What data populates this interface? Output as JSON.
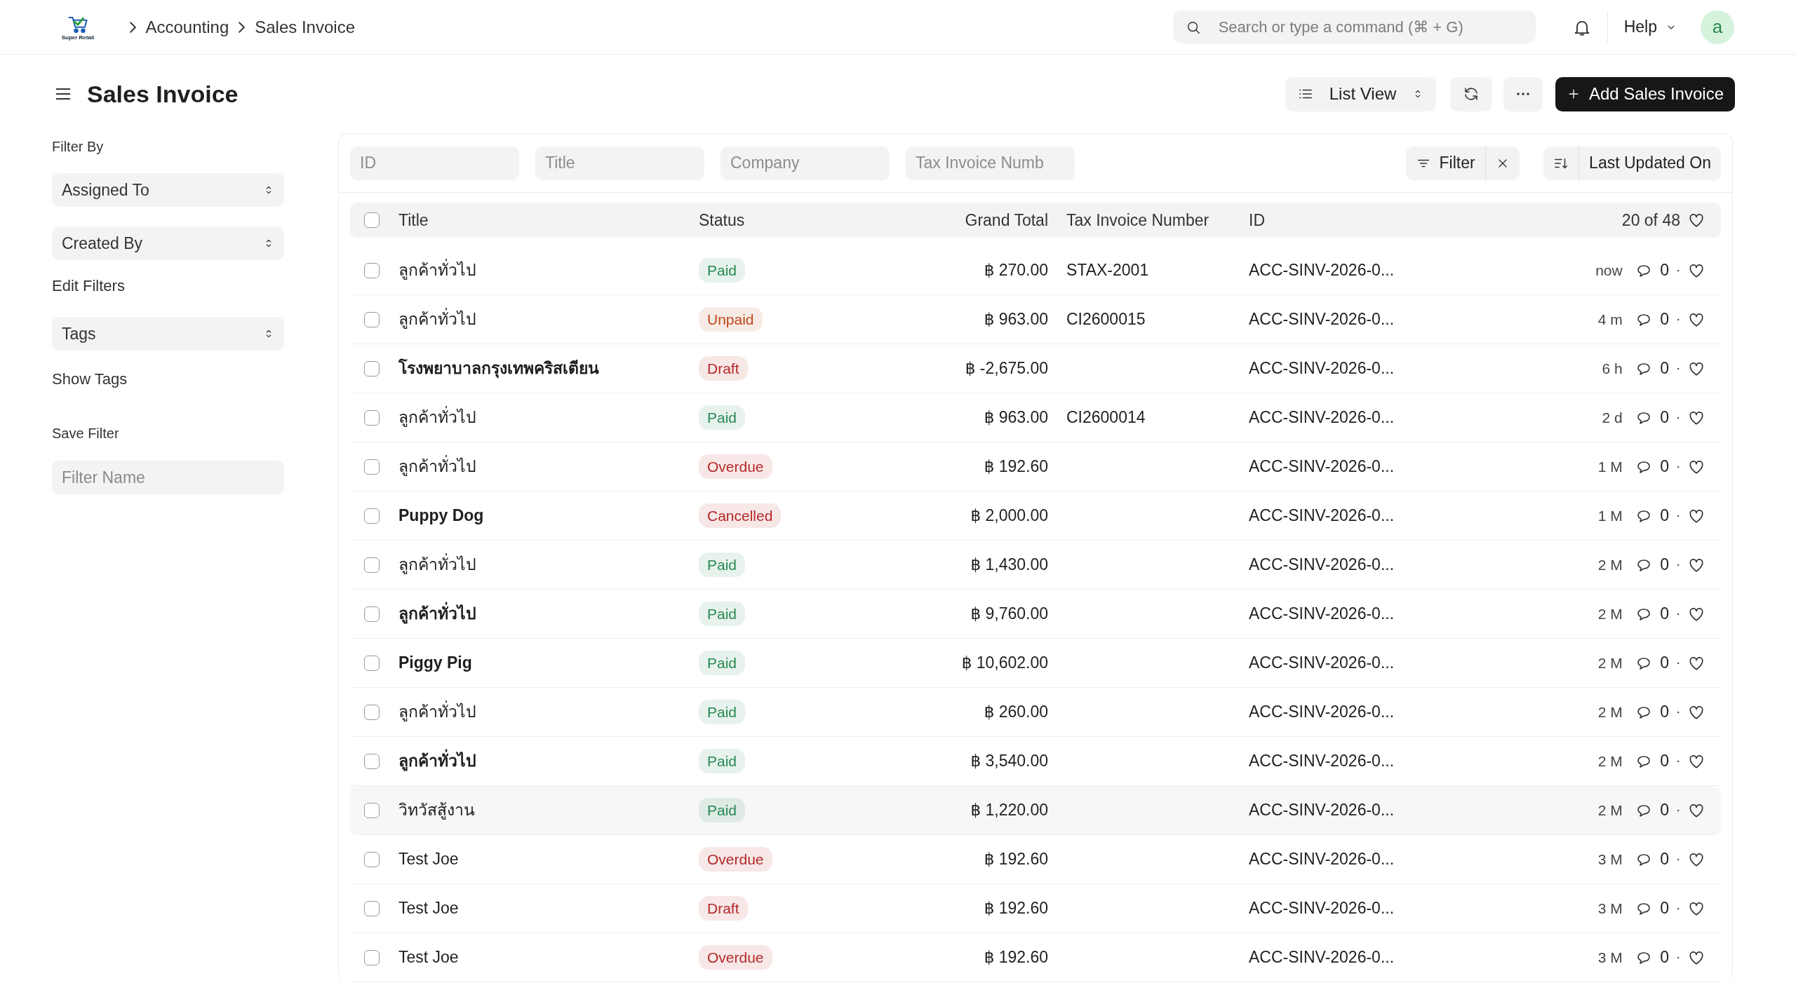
{
  "topbar": {
    "logo_text": "Super Retail",
    "breadcrumbs": [
      "Accounting",
      "Sales Invoice"
    ],
    "search": {
      "placeholder": "Search or type a command (⌘ + G)"
    },
    "help": "Help",
    "avatar": "a"
  },
  "page": {
    "title": "Sales Invoice",
    "view_switcher": "List View",
    "primary_action": "Add Sales Invoice"
  },
  "sidebar": {
    "filter_by": "Filter By",
    "filters": [
      {
        "label": "Assigned To"
      },
      {
        "label": "Created By"
      }
    ],
    "edit_filters": "Edit Filters",
    "tags": "Tags",
    "show_tags": "Show Tags",
    "save_filter": "Save Filter",
    "filter_name": {
      "placeholder": "Filter Name"
    }
  },
  "filter_bar": {
    "fields": [
      {
        "placeholder": "ID"
      },
      {
        "placeholder": "Title"
      },
      {
        "placeholder": "Company"
      },
      {
        "placeholder": "Tax Invoice Numb"
      }
    ],
    "filter_button": "Filter",
    "sort_label": "Last Updated On"
  },
  "table": {
    "header_checked": false,
    "columns": [
      "Title",
      "Status",
      "Grand Total",
      "Tax Invoice Number",
      "ID"
    ],
    "count": "20 of 48",
    "rows": [
      {
        "checked": false,
        "hovered": false,
        "unread": false,
        "title": "ลูกค้าทั่วไป",
        "status": "Paid",
        "color": "#278a53",
        "grand_total": "฿ 270.00",
        "tax_invoice_number": "STAX-2001",
        "id": "ACC-SINV-2026-0...",
        "modified": "now",
        "comments": "0"
      },
      {
        "checked": false,
        "hovered": false,
        "unread": false,
        "title": "ลูกค้าทั่วไป",
        "status": "Unpaid",
        "color": "#c0461b",
        "grand_total": "฿ 963.00",
        "tax_invoice_number": "CI2600015",
        "id": "ACC-SINV-2026-0...",
        "modified": "4 m",
        "comments": "0"
      },
      {
        "checked": false,
        "hovered": false,
        "unread": true,
        "title": "โรงพยาบาลกรุงเทพคริสเตียน",
        "status": "Draft",
        "color": "#b42828",
        "grand_total": "฿ -2,675.00",
        "id": "ACC-SINV-2026-0...",
        "modified": "6 h",
        "comments": "0"
      },
      {
        "checked": false,
        "hovered": false,
        "unread": false,
        "title": "ลูกค้าทั่วไป",
        "status": "Paid",
        "color": "#278a53",
        "grand_total": "฿ 963.00",
        "tax_invoice_number": "CI2600014",
        "id": "ACC-SINV-2026-0...",
        "modified": "2 d",
        "comments": "0"
      },
      {
        "checked": false,
        "hovered": false,
        "unread": false,
        "title": "ลูกค้าทั่วไป",
        "status": "Overdue",
        "color": "#b42828",
        "grand_total": "฿ 192.60",
        "id": "ACC-SINV-2026-0...",
        "modified": "1 M",
        "comments": "0"
      },
      {
        "checked": false,
        "hovered": false,
        "unread": true,
        "title": "Puppy Dog",
        "status": "Cancelled",
        "color": "#b42828",
        "grand_total": "฿ 2,000.00",
        "id": "ACC-SINV-2026-0...",
        "modified": "1 M",
        "comments": "0"
      },
      {
        "checked": false,
        "hovered": false,
        "unread": false,
        "title": "ลูกค้าทั่วไป",
        "status": "Paid",
        "color": "#278a53",
        "grand_total": "฿ 1,430.00",
        "id": "ACC-SINV-2026-0...",
        "modified": "2 M",
        "comments": "0"
      },
      {
        "checked": false,
        "hovered": false,
        "unread": true,
        "title": "ลูกค้าทั่วไป",
        "status": "Paid",
        "color": "#278a53",
        "grand_total": "฿ 9,760.00",
        "id": "ACC-SINV-2026-0...",
        "modified": "2 M",
        "comments": "0"
      },
      {
        "checked": false,
        "hovered": false,
        "unread": true,
        "title": "Piggy Pig",
        "status": "Paid",
        "color": "#278a53",
        "grand_total": "฿ 10,602.00",
        "id": "ACC-SINV-2026-0...",
        "modified": "2 M",
        "comments": "0"
      },
      {
        "checked": false,
        "hovered": false,
        "unread": false,
        "title": "ลูกค้าทั่วไป",
        "status": "Paid",
        "color": "#278a53",
        "grand_total": "฿ 260.00",
        "id": "ACC-SINV-2026-0...",
        "modified": "2 M",
        "comments": "0"
      },
      {
        "checked": false,
        "hovered": false,
        "unread": true,
        "title": "ลูกค้าทั่วไป",
        "status": "Paid",
        "color": "#278a53",
        "grand_total": "฿ 3,540.00",
        "id": "ACC-SINV-2026-0...",
        "modified": "2 M",
        "comments": "0"
      },
      {
        "checked": false,
        "hovered": true,
        "unread": false,
        "title": "วิทวัสสู้งาน",
        "status": "Paid",
        "color": "#278a53",
        "grand_total": "฿ 1,220.00",
        "id": "ACC-SINV-2026-0...",
        "modified": "2 M",
        "comments": "0"
      },
      {
        "checked": false,
        "hovered": false,
        "unread": false,
        "title": "Test Joe",
        "status": "Overdue",
        "color": "#b42828",
        "grand_total": "฿ 192.60",
        "id": "ACC-SINV-2026-0...",
        "modified": "3 M",
        "comments": "0"
      },
      {
        "checked": false,
        "hovered": false,
        "unread": false,
        "title": "Test Joe",
        "status": "Draft",
        "color": "#b42828",
        "grand_total": "฿ 192.60",
        "id": "ACC-SINV-2026-0...",
        "modified": "3 M",
        "comments": "0"
      },
      {
        "checked": false,
        "hovered": false,
        "unread": false,
        "title": "Test Joe",
        "status": "Overdue",
        "color": "#b42828",
        "grand_total": "฿ 192.60",
        "id": "ACC-SINV-2026-0...",
        "modified": "3 M",
        "comments": "0"
      }
    ]
  }
}
